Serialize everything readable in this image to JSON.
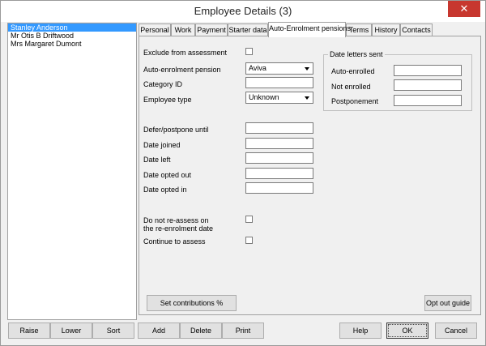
{
  "window": {
    "title": "Employee Details (3)",
    "close_glyph": "✕"
  },
  "employees": [
    "Stanley Anderson",
    "Mr Otis B Driftwood",
    "Mrs Margaret Dumont"
  ],
  "tabs": [
    "Personal",
    "Work",
    "Payment",
    "Starter data",
    "Auto-Enrolment pensions",
    "Terms",
    "History",
    "Contacts"
  ],
  "form": {
    "exclude_label": "Exclude from assessment",
    "pension_label": "Auto-enrolment pension",
    "pension_value": "Aviva",
    "category_label": "Category ID",
    "category_value": "",
    "type_label": "Employee type",
    "type_value": "Unknown",
    "defer_label": "Defer/postpone until",
    "joined_label": "Date joined",
    "left_label": "Date left",
    "opted_out_label": "Date opted out",
    "opted_in_label": "Date opted in",
    "no_reassess_label_1": "Do not re-assess on",
    "no_reassess_label_2": "the re-enrolment date",
    "continue_label": "Continue to assess"
  },
  "letters": {
    "title": "Date letters sent",
    "auto_enrolled_label": "Auto-enrolled",
    "not_enrolled_label": "Not enrolled",
    "postponement_label": "Postponement"
  },
  "panel_buttons": {
    "set_contributions": "Set contributions %",
    "opt_out_guide": "Opt out guide"
  },
  "bottom_buttons": {
    "raise": "Raise",
    "lower": "Lower",
    "sort": "Sort",
    "add": "Add",
    "delete": "Delete",
    "print": "Print",
    "help": "Help",
    "ok": "OK",
    "cancel": "Cancel"
  },
  "colors": {
    "selection": "#3399ff",
    "close_button": "#c7372f",
    "face": "#f0f0f0"
  }
}
